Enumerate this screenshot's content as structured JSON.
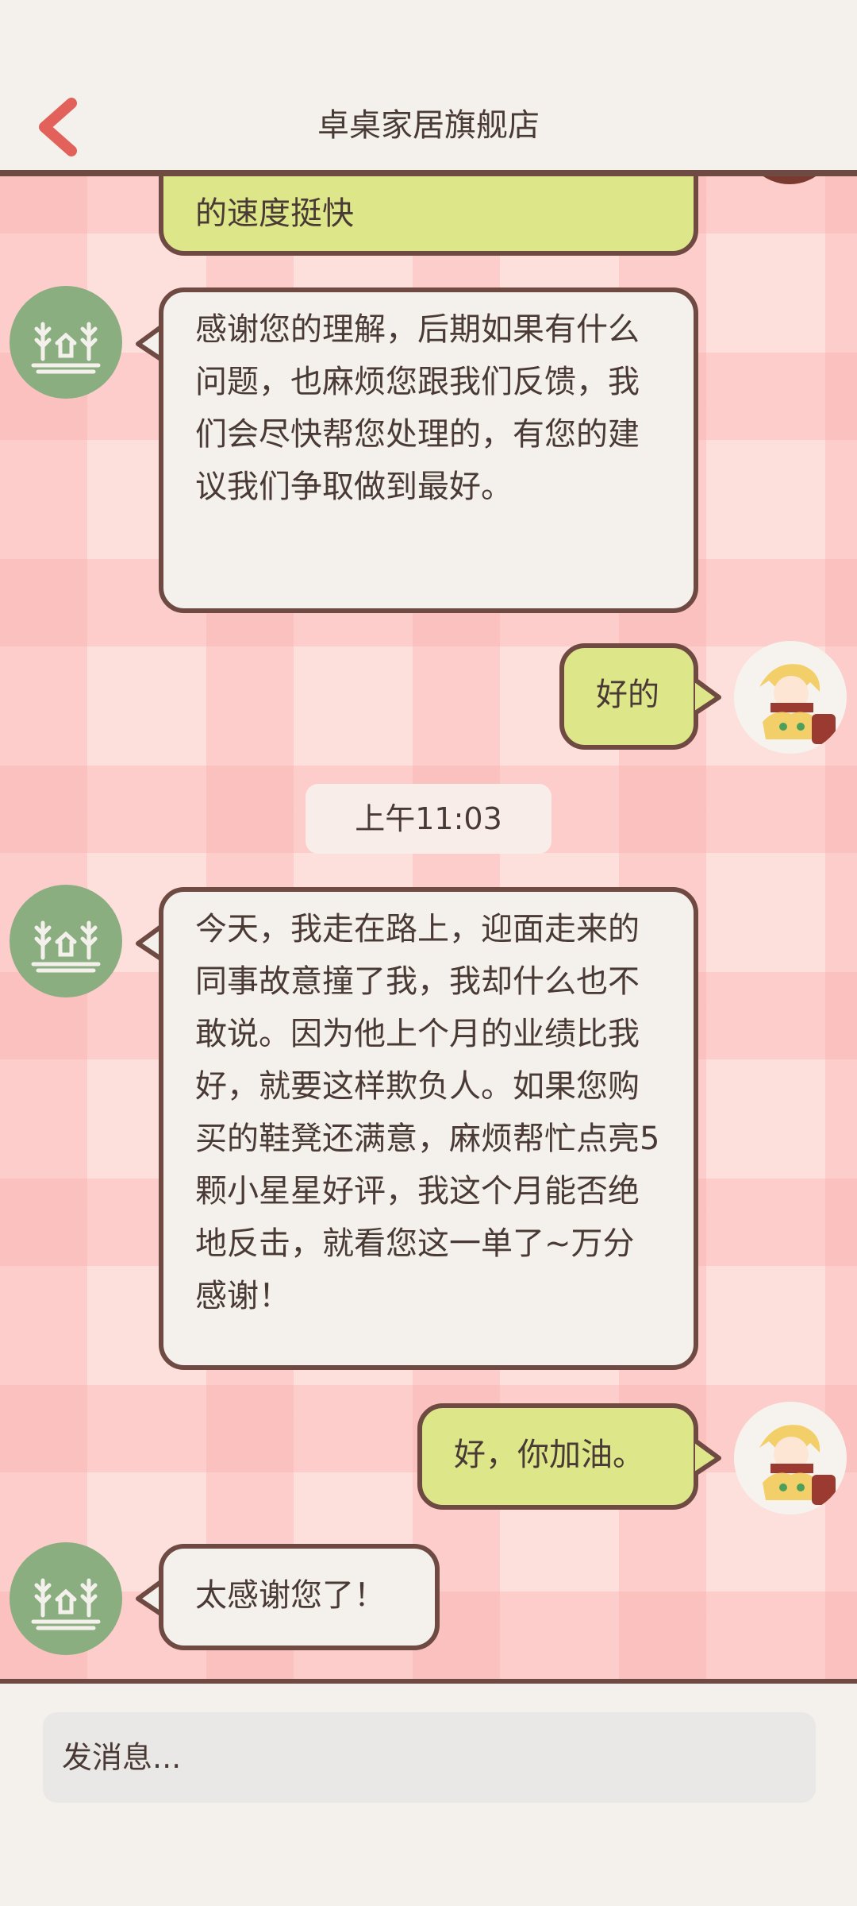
{
  "header": {
    "title": "卓桌家居旗舰店"
  },
  "messages": [
    {
      "side": "out",
      "text": "的速度挺快"
    },
    {
      "side": "in",
      "text": "感谢您的理解，后期如果有什么问题，也麻烦您跟我们反馈，我们会尽快帮您处理的，有您的建议我们争取做到最好。"
    },
    {
      "side": "out",
      "text": "好的"
    },
    {
      "side": "in",
      "text": "今天，我走在路上，迎面走来的同事故意撞了我，我却什么也不敢说。因为他上个月的业绩比我好，就要这样欺负人。如果您购买的鞋凳还满意，麻烦帮忙点亮5颗小星星好评，我这个月能否绝地反击，就看您这一单了~万分感谢！"
    },
    {
      "side": "out",
      "text": "好，你加油。"
    },
    {
      "side": "in",
      "text": "太感谢您了！"
    }
  ],
  "timestamp": "上午11:03",
  "input": {
    "placeholder": "发消息..."
  },
  "colors": {
    "accent_red": "#e2615a",
    "bubble_out": "#dde689",
    "bubble_in": "#f4f1ec",
    "border": "#6e4a42",
    "shop_avatar": "#8aae80"
  },
  "icons": {
    "back": "chevron-left-icon",
    "shop_avatar": "house-trees-icon",
    "user_avatar": "anime-avatar"
  }
}
